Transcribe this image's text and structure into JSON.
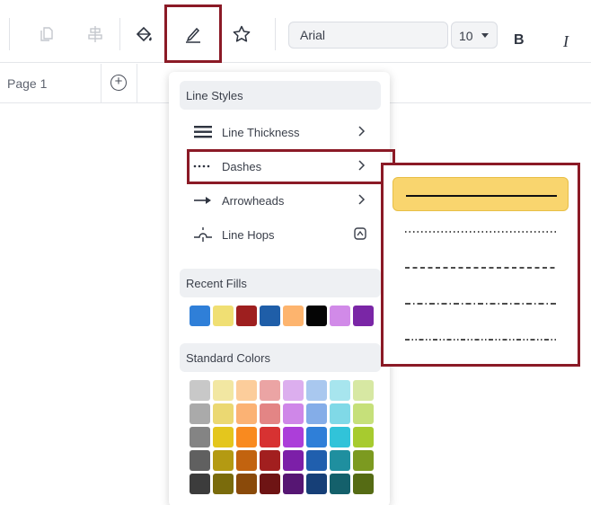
{
  "toolbar": {
    "font_value": "Arial",
    "font_size": "10",
    "bold_label": "B",
    "italic_label": "I",
    "icons": [
      "duplicate-icon",
      "align-icon",
      "fill-bucket-icon",
      "line-pen-icon",
      "star-icon"
    ]
  },
  "tabs": {
    "page_label": "Page 1",
    "add_label": "+"
  },
  "menu": {
    "line_styles_header": "Line Styles",
    "items": [
      {
        "label": "Line Thickness",
        "icon": "line-thickness-icon"
      },
      {
        "label": "Dashes",
        "icon": "dashes-icon"
      },
      {
        "label": "Arrowheads",
        "icon": "arrowhead-icon"
      },
      {
        "label": "Line Hops",
        "icon": "line-hops-icon"
      }
    ],
    "recent_fills_header": "Recent Fills",
    "standard_colors_header": "Standard Colors"
  },
  "recent_fills": [
    "#2f7fd8",
    "#f0df73",
    "#9e1f1f",
    "#1f5ea8",
    "#fdb46e",
    "#050505",
    "#d18ae8",
    "#7a26a6"
  ],
  "standard_colors": [
    [
      "#c8c8c8",
      "#f2e7a2",
      "#fccd9b",
      "#eba4a4",
      "#dcaeee",
      "#a9c8ef",
      "#a7e5ee",
      "#d7e8a3"
    ],
    [
      "#aaaaaa",
      "#ebd872",
      "#fbb274",
      "#e38585",
      "#cf87e8",
      "#84ade8",
      "#80d9e7",
      "#c6e07a"
    ],
    [
      "#848484",
      "#e4c61d",
      "#f98a1f",
      "#d73232",
      "#ac3ed9",
      "#2f7fd8",
      "#31c3d9",
      "#a7cb2f"
    ],
    [
      "#606060",
      "#b49a12",
      "#c2630f",
      "#a21f1f",
      "#7c1fa8",
      "#205fae",
      "#1f8f9f",
      "#7c9a20"
    ],
    [
      "#3c3c3c",
      "#7a6b0c",
      "#8a4a0a",
      "#6e1414",
      "#561673",
      "#163f77",
      "#14606b",
      "#556b14"
    ]
  ],
  "dash_options": [
    "solid",
    "dotted",
    "dashed",
    "dash-dot",
    "dash-dot-dot"
  ],
  "selected_dash": "solid",
  "accent_color": "#8b1a26",
  "selected_color": "#f9d56e"
}
